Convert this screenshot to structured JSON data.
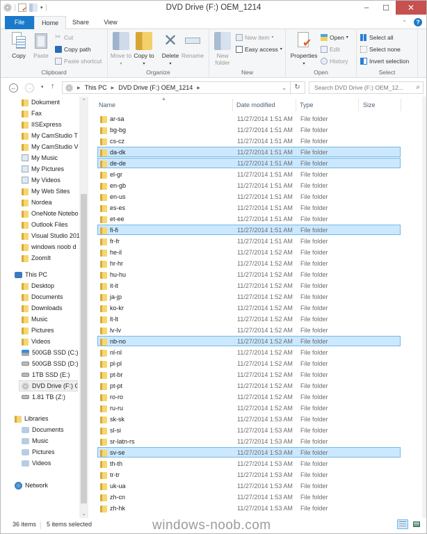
{
  "window": {
    "title": "DVD Drive (F:) OEM_1214",
    "minimize": "–",
    "maximize": "☐",
    "close": "✕"
  },
  "tabs": [
    {
      "label": "File",
      "active": false
    },
    {
      "label": "Home",
      "active": true
    },
    {
      "label": "Share",
      "active": false
    },
    {
      "label": "View",
      "active": false
    }
  ],
  "ribbon": {
    "clipboard": {
      "label": "Clipboard",
      "copy": "Copy",
      "paste": "Paste",
      "cut": "Cut",
      "copy_path": "Copy path",
      "paste_shortcut": "Paste shortcut"
    },
    "organize": {
      "label": "Organize",
      "move_to": "Move to",
      "copy_to": "Copy to",
      "delete": "Delete",
      "rename": "Rename"
    },
    "new": {
      "label": "New",
      "new_folder": "New folder",
      "new_item": "New item",
      "easy_access": "Easy access"
    },
    "open": {
      "label": "Open",
      "properties": "Properties",
      "open": "Open",
      "edit": "Edit",
      "history": "History"
    },
    "select": {
      "label": "Select",
      "select_all": "Select all",
      "select_none": "Select none",
      "invert_selection": "Invert selection"
    }
  },
  "address": {
    "crumbs": [
      "This PC",
      "DVD Drive (F:) OEM_1214"
    ],
    "search_placeholder": "Search DVD Drive (F:) OEM_12..."
  },
  "navpane": {
    "favorites_items": [
      {
        "label": "Dokument",
        "icon": "folder-icon"
      },
      {
        "label": "Fax",
        "icon": "folder-icon"
      },
      {
        "label": "IISExpress",
        "icon": "folder-icon"
      },
      {
        "label": "My CamStudio T",
        "icon": "folder-icon"
      },
      {
        "label": "My CamStudio V",
        "icon": "folder-icon"
      },
      {
        "label": "My Music",
        "icon": "shortcut-icon"
      },
      {
        "label": "My Pictures",
        "icon": "shortcut-icon"
      },
      {
        "label": "My Videos",
        "icon": "shortcut-icon"
      },
      {
        "label": "My Web Sites",
        "icon": "folder-icon"
      },
      {
        "label": "Nordea",
        "icon": "folder-icon"
      },
      {
        "label": "OneNote Notebo",
        "icon": "folder-icon"
      },
      {
        "label": "Outlook Files",
        "icon": "folder-icon"
      },
      {
        "label": "Visual Studio 201",
        "icon": "folder-icon"
      },
      {
        "label": "windows noob d",
        "icon": "folder-icon"
      },
      {
        "label": "ZoomIt",
        "icon": "folder-icon"
      }
    ],
    "this_pc": "This PC",
    "this_pc_items": [
      {
        "label": "Desktop",
        "icon": "desktop-folder-icon"
      },
      {
        "label": "Documents",
        "icon": "documents-folder-icon"
      },
      {
        "label": "Downloads",
        "icon": "downloads-folder-icon"
      },
      {
        "label": "Music",
        "icon": "music-folder-icon"
      },
      {
        "label": "Pictures",
        "icon": "pictures-folder-icon"
      },
      {
        "label": "Videos",
        "icon": "videos-folder-icon"
      },
      {
        "label": "500GB SSD (C:)",
        "icon": "system-drive-icon"
      },
      {
        "label": "500GB SSD (D:)",
        "icon": "drive-icon"
      },
      {
        "label": "1TB SSD (E:)",
        "icon": "drive-icon"
      },
      {
        "label": "DVD Drive (F:) OE",
        "icon": "dvd-drive-icon",
        "selected": true
      },
      {
        "label": "1.81 TB (Z:)",
        "icon": "drive-icon"
      }
    ],
    "libraries": "Libraries",
    "library_items": [
      {
        "label": "Documents",
        "icon": "documents-library-icon"
      },
      {
        "label": "Music",
        "icon": "music-library-icon"
      },
      {
        "label": "Pictures",
        "icon": "pictures-library-icon"
      },
      {
        "label": "Videos",
        "icon": "videos-library-icon"
      }
    ],
    "network": "Network"
  },
  "filelist": {
    "columns": [
      "Name",
      "Date modified",
      "Type",
      "Size"
    ],
    "rows": [
      {
        "name": "ar-sa",
        "date": "11/27/2014 1:51 AM",
        "type": "File folder",
        "selected": false
      },
      {
        "name": "bg-bg",
        "date": "11/27/2014 1:51 AM",
        "type": "File folder",
        "selected": false
      },
      {
        "name": "cs-cz",
        "date": "11/27/2014 1:51 AM",
        "type": "File folder",
        "selected": false
      },
      {
        "name": "da-dk",
        "date": "11/27/2014 1:51 AM",
        "type": "File folder",
        "selected": true
      },
      {
        "name": "de-de",
        "date": "11/27/2014 1:51 AM",
        "type": "File folder",
        "selected": true
      },
      {
        "name": "el-gr",
        "date": "11/27/2014 1:51 AM",
        "type": "File folder",
        "selected": false
      },
      {
        "name": "en-gb",
        "date": "11/27/2014 1:51 AM",
        "type": "File folder",
        "selected": false
      },
      {
        "name": "en-us",
        "date": "11/27/2014 1:51 AM",
        "type": "File folder",
        "selected": false
      },
      {
        "name": "es-es",
        "date": "11/27/2014 1:51 AM",
        "type": "File folder",
        "selected": false
      },
      {
        "name": "et-ee",
        "date": "11/27/2014 1:51 AM",
        "type": "File folder",
        "selected": false
      },
      {
        "name": "fi-fi",
        "date": "11/27/2014 1:51 AM",
        "type": "File folder",
        "selected": true
      },
      {
        "name": "fr-fr",
        "date": "11/27/2014 1:51 AM",
        "type": "File folder",
        "selected": false
      },
      {
        "name": "he-il",
        "date": "11/27/2014 1:52 AM",
        "type": "File folder",
        "selected": false
      },
      {
        "name": "hr-hr",
        "date": "11/27/2014 1:52 AM",
        "type": "File folder",
        "selected": false
      },
      {
        "name": "hu-hu",
        "date": "11/27/2014 1:52 AM",
        "type": "File folder",
        "selected": false
      },
      {
        "name": "it-it",
        "date": "11/27/2014 1:52 AM",
        "type": "File folder",
        "selected": false
      },
      {
        "name": "ja-jp",
        "date": "11/27/2014 1:52 AM",
        "type": "File folder",
        "selected": false
      },
      {
        "name": "ko-kr",
        "date": "11/27/2014 1:52 AM",
        "type": "File folder",
        "selected": false
      },
      {
        "name": "lt-lt",
        "date": "11/27/2014 1:52 AM",
        "type": "File folder",
        "selected": false
      },
      {
        "name": "lv-lv",
        "date": "11/27/2014 1:52 AM",
        "type": "File folder",
        "selected": false
      },
      {
        "name": "nb-no",
        "date": "11/27/2014 1:52 AM",
        "type": "File folder",
        "selected": true
      },
      {
        "name": "nl-nl",
        "date": "11/27/2014 1:52 AM",
        "type": "File folder",
        "selected": false
      },
      {
        "name": "pl-pl",
        "date": "11/27/2014 1:52 AM",
        "type": "File folder",
        "selected": false
      },
      {
        "name": "pt-br",
        "date": "11/27/2014 1:52 AM",
        "type": "File folder",
        "selected": false
      },
      {
        "name": "pt-pt",
        "date": "11/27/2014 1:52 AM",
        "type": "File folder",
        "selected": false
      },
      {
        "name": "ro-ro",
        "date": "11/27/2014 1:52 AM",
        "type": "File folder",
        "selected": false
      },
      {
        "name": "ru-ru",
        "date": "11/27/2014 1:52 AM",
        "type": "File folder",
        "selected": false
      },
      {
        "name": "sk-sk",
        "date": "11/27/2014 1:53 AM",
        "type": "File folder",
        "selected": false
      },
      {
        "name": "sl-si",
        "date": "11/27/2014 1:53 AM",
        "type": "File folder",
        "selected": false
      },
      {
        "name": "sr-latn-rs",
        "date": "11/27/2014 1:53 AM",
        "type": "File folder",
        "selected": false
      },
      {
        "name": "sv-se",
        "date": "11/27/2014 1:53 AM",
        "type": "File folder",
        "selected": true
      },
      {
        "name": "th-th",
        "date": "11/27/2014 1:53 AM",
        "type": "File folder",
        "selected": false
      },
      {
        "name": "tr-tr",
        "date": "11/27/2014 1:53 AM",
        "type": "File folder",
        "selected": false
      },
      {
        "name": "uk-ua",
        "date": "11/27/2014 1:53 AM",
        "type": "File folder",
        "selected": false
      },
      {
        "name": "zh-cn",
        "date": "11/27/2014 1:53 AM",
        "type": "File folder",
        "selected": false
      },
      {
        "name": "zh-hk",
        "date": "11/27/2014 1:53 AM",
        "type": "File folder",
        "selected": false
      }
    ]
  },
  "status": {
    "item_count": "36 items",
    "selected_count": "5 items selected"
  },
  "watermark": "windows-noob.com",
  "colors": {
    "accent": "#1979ca",
    "selection_bg": "#cce8ff",
    "selection_border": "#74b8e4",
    "close_button": "#c75050"
  }
}
